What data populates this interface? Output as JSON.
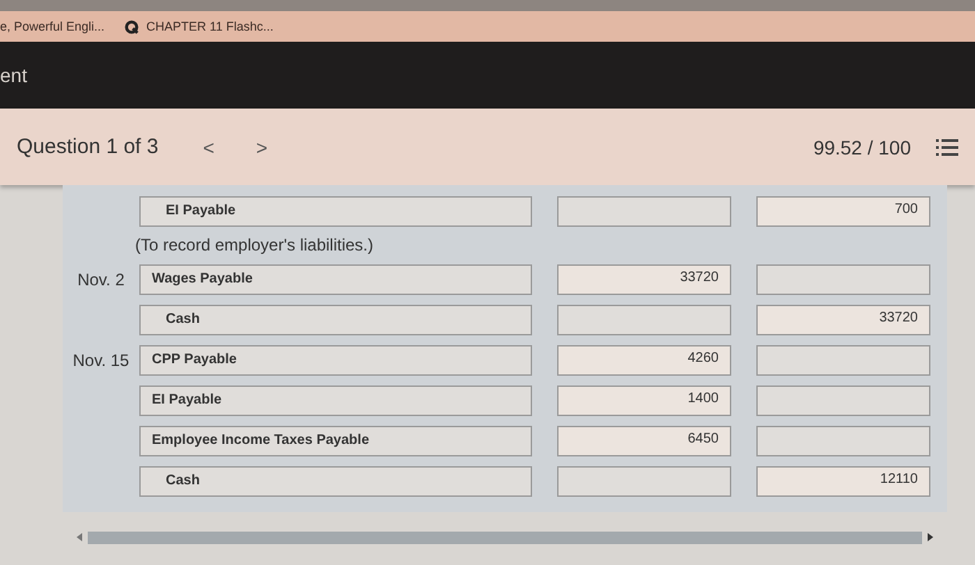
{
  "bookmarks": [
    {
      "label": "e, Powerful Engli..."
    },
    {
      "label": "CHAPTER 11 Flashc..."
    }
  ],
  "app_bar": {
    "title": "ent"
  },
  "header": {
    "question": "Question 1 of 3",
    "prev": "<",
    "next": ">",
    "score": "99.52 / 100"
  },
  "entries": [
    {
      "kind": "line",
      "account": "EI Payable",
      "credit_side": true,
      "credit": "700"
    },
    {
      "kind": "note",
      "text": "(To record employer's liabilities.)"
    },
    {
      "kind": "line",
      "date": "Nov. 2",
      "account": "Wages Payable",
      "credit_side": false,
      "debit": "33720"
    },
    {
      "kind": "line",
      "account": "Cash",
      "credit_side": true,
      "credit": "33720"
    },
    {
      "kind": "line",
      "date": "Nov. 15",
      "account": "CPP Payable",
      "credit_side": false,
      "debit": "4260"
    },
    {
      "kind": "line",
      "account": "EI Payable",
      "credit_side": false,
      "debit": "1400"
    },
    {
      "kind": "line",
      "account": "Employee Income Taxes Payable",
      "credit_side": false,
      "debit": "6450"
    },
    {
      "kind": "line",
      "account": "Cash",
      "credit_side": true,
      "credit": "12110"
    }
  ]
}
